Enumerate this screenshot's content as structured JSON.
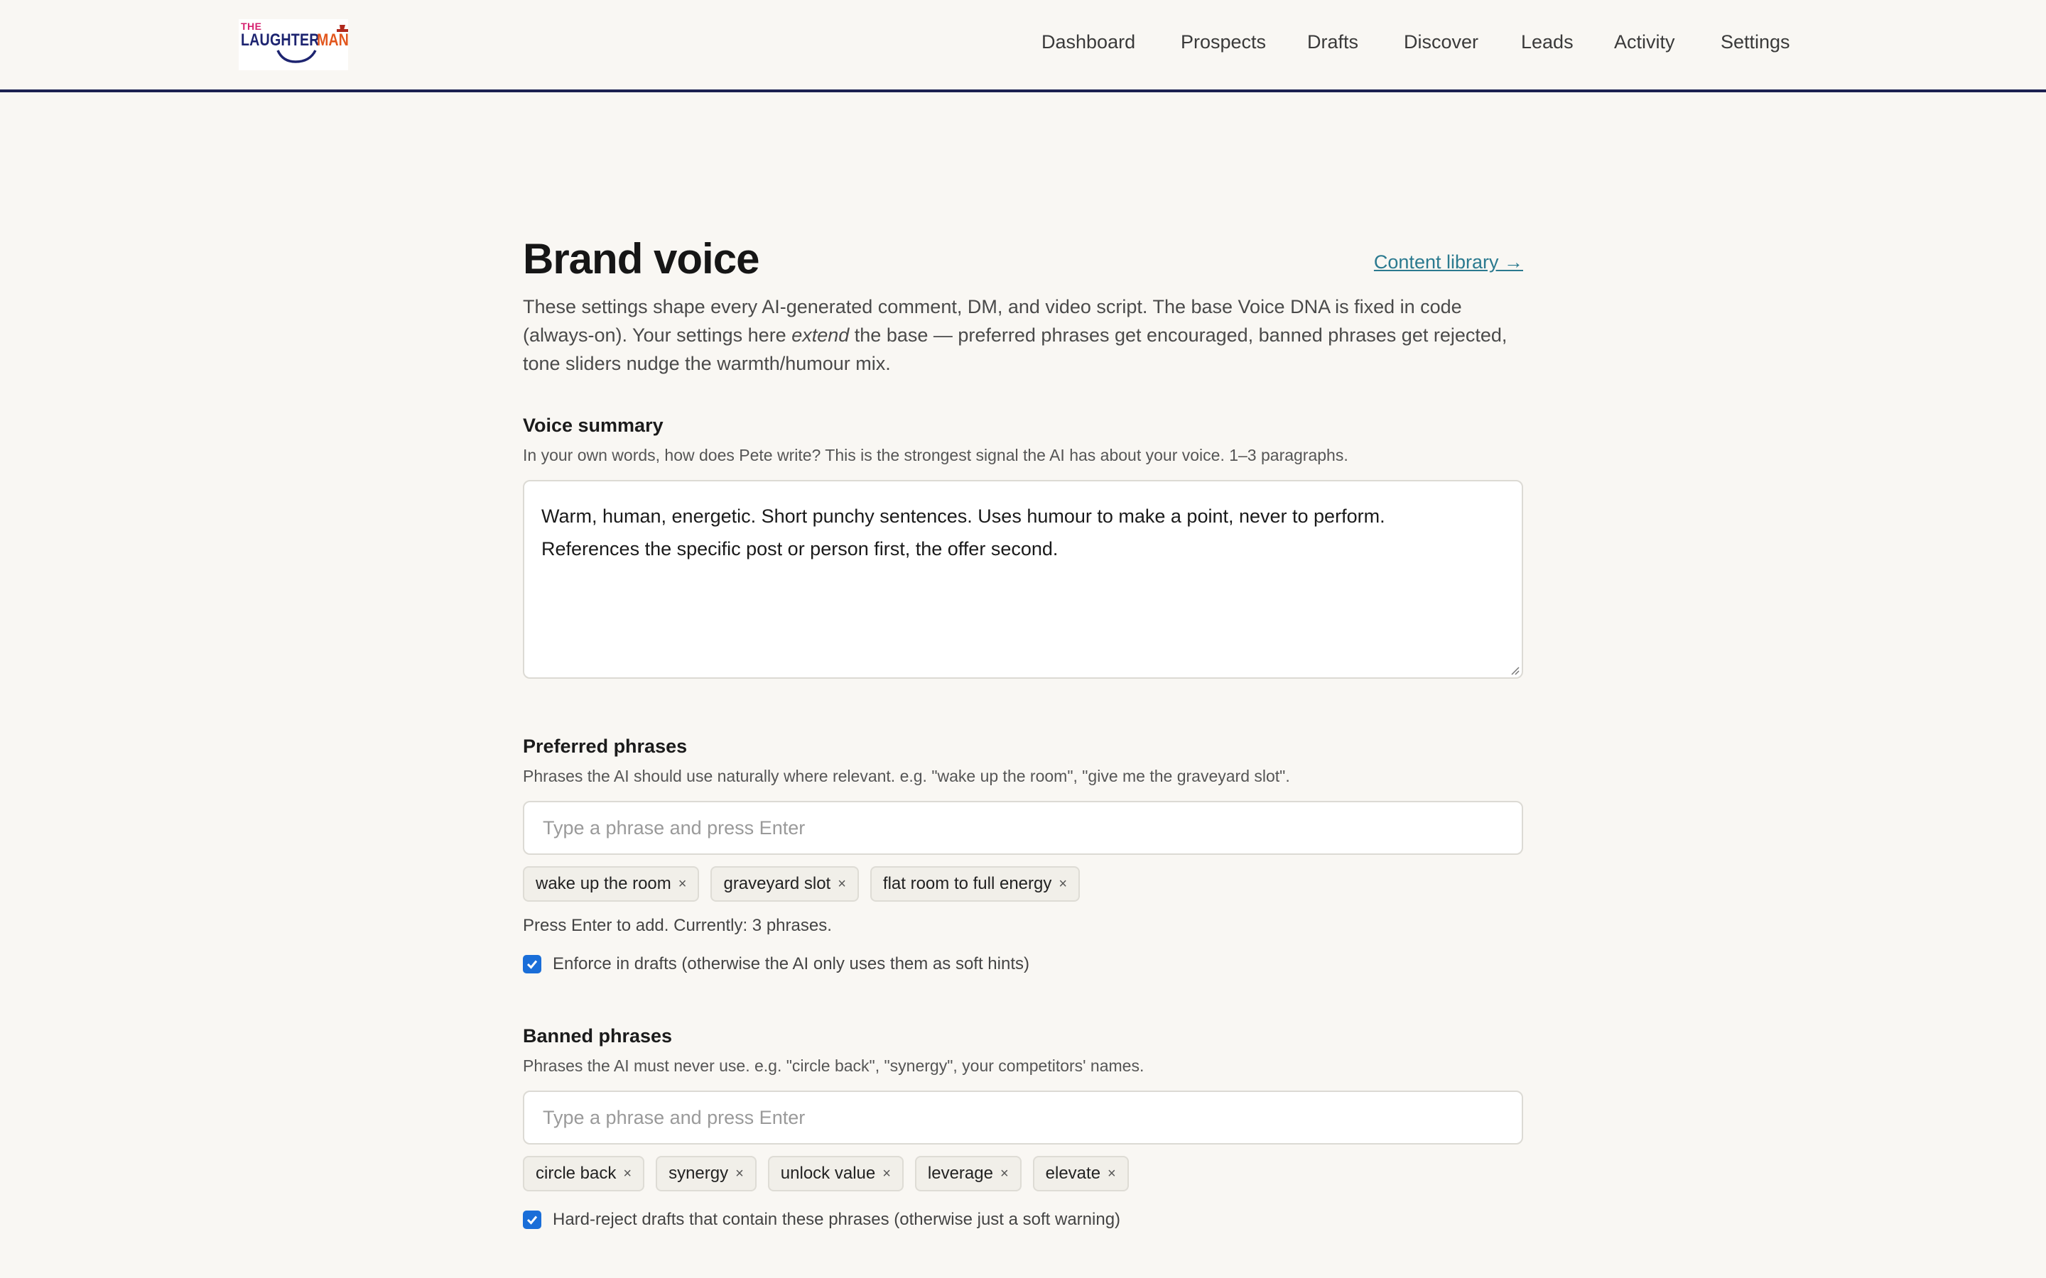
{
  "brand": {
    "logo_top": "THE",
    "logo_main": "LAUGHTER",
    "logo_accent": "MAN",
    "colors": {
      "pink": "#d6206f",
      "navy": "#1d2470",
      "orange": "#e2571e",
      "hat": "#b0291d"
    }
  },
  "nav": {
    "items": [
      {
        "label": "Dashboard"
      },
      {
        "label": "Prospects"
      },
      {
        "label": "Drafts"
      },
      {
        "label": "Discover"
      },
      {
        "label": "Leads"
      },
      {
        "label": "Activity"
      },
      {
        "label": "Settings"
      }
    ]
  },
  "page": {
    "title": "Brand voice",
    "content_library_link": "Content library →",
    "intro_part1": "These settings shape every AI-generated comment, DM, and video script. The base Voice DNA is fixed in code (always-on). Your settings here ",
    "intro_em": "extend",
    "intro_part2": " the base — preferred phrases get encouraged, banned phrases get rejected, tone sliders nudge the warmth/humour mix."
  },
  "voice_summary": {
    "label": "Voice summary",
    "help": "In your own words, how does Pete write? This is the strongest signal the AI has about your voice. 1–3 paragraphs.",
    "value_line1": "Warm, human, energetic. Short punchy sentences. Uses humour to make a point, never to perform.",
    "value_line2": "References the specific post or person first, the offer second."
  },
  "preferred": {
    "label": "Preferred phrases",
    "help": "Phrases the AI should use naturally where relevant. e.g. \"wake up the room\", \"give me the graveyard slot\".",
    "placeholder": "Type a phrase and press Enter",
    "chips": [
      {
        "text": "wake up the room",
        "remove": "×"
      },
      {
        "text": "graveyard slot",
        "remove": "×"
      },
      {
        "text": "flat room to full energy",
        "remove": "×"
      }
    ],
    "count_note": "Press Enter to add. Currently: 3 phrases.",
    "enforce_label": "Enforce in drafts (otherwise the AI only uses them as soft hints)",
    "enforce_checked": true
  },
  "banned": {
    "label": "Banned phrases",
    "help": "Phrases the AI must never use. e.g. \"circle back\", \"synergy\", your competitors' names.",
    "placeholder": "Type a phrase and press Enter",
    "chips": [
      {
        "text": "circle back",
        "remove": "×"
      },
      {
        "text": "synergy",
        "remove": "×"
      },
      {
        "text": "unlock value",
        "remove": "×"
      },
      {
        "text": "leverage",
        "remove": "×"
      },
      {
        "text": "elevate",
        "remove": "×"
      }
    ],
    "hard_reject_label": "Hard-reject drafts that contain these phrases (otherwise just a soft warning)",
    "hard_reject_checked": true
  },
  "colors": {
    "accent": "#1a6ed8",
    "link": "#2b7a8f",
    "header_rule": "#1c2150",
    "background": "#f9f7f3"
  }
}
